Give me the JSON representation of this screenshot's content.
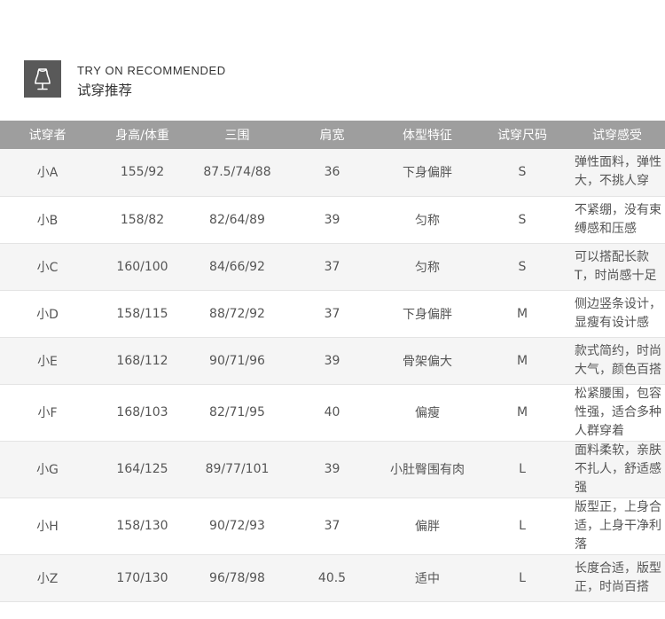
{
  "header": {
    "icon": "mannequin-icon",
    "title_en": "TRY ON RECOMMENDED",
    "title_cn": "试穿推荐"
  },
  "table": {
    "columns": [
      "试穿者",
      "身高/体重",
      "三围",
      "肩宽",
      "体型特征",
      "试穿尺码",
      "试穿感受"
    ],
    "rows": [
      {
        "name": "小A",
        "hw": "155/92",
        "measure": "87.5/74/88",
        "shoulder": "36",
        "body": "下身偏胖",
        "size": "S",
        "feel": "弹性面料，弹性大，不挑人穿"
      },
      {
        "name": "小B",
        "hw": "158/82",
        "measure": "82/64/89",
        "shoulder": "39",
        "body": "匀称",
        "size": "S",
        "feel": "不紧绷，没有束缚感和压感"
      },
      {
        "name": "小C",
        "hw": "160/100",
        "measure": "84/66/92",
        "shoulder": "37",
        "body": "匀称",
        "size": "S",
        "feel": "可以搭配长款T，时尚感十足"
      },
      {
        "name": "小D",
        "hw": "158/115",
        "measure": "88/72/92",
        "shoulder": "37",
        "body": "下身偏胖",
        "size": "M",
        "feel": "侧边竖条设计，显瘦有设计感"
      },
      {
        "name": "小E",
        "hw": "168/112",
        "measure": "90/71/96",
        "shoulder": "39",
        "body": "骨架偏大",
        "size": "M",
        "feel": "款式简约，时尚大气，颜色百搭"
      },
      {
        "name": "小F",
        "hw": "168/103",
        "measure": "82/71/95",
        "shoulder": "40",
        "body": "偏瘦",
        "size": "M",
        "feel": "松紧腰围，包容性强，适合多种人群穿着"
      },
      {
        "name": "小G",
        "hw": "164/125",
        "measure": "89/77/101",
        "shoulder": "39",
        "body": "小肚臀围有肉",
        "size": "L",
        "feel": "面料柔软，亲肤不扎人，舒适感强"
      },
      {
        "name": "小H",
        "hw": "158/130",
        "measure": "90/72/93",
        "shoulder": "37",
        "body": "偏胖",
        "size": "L",
        "feel": "版型正，上身合适，上身干净利落"
      },
      {
        "name": "小Z",
        "hw": "170/130",
        "measure": "96/78/98",
        "shoulder": "40.5",
        "body": "适中",
        "size": "L",
        "feel": "长度合适，版型正，时尚百搭"
      }
    ]
  },
  "colors": {
    "header_bg": "#9e9e9e",
    "icon_bg": "#595959",
    "row_alt": "#f5f5f5",
    "text": "#555555"
  }
}
